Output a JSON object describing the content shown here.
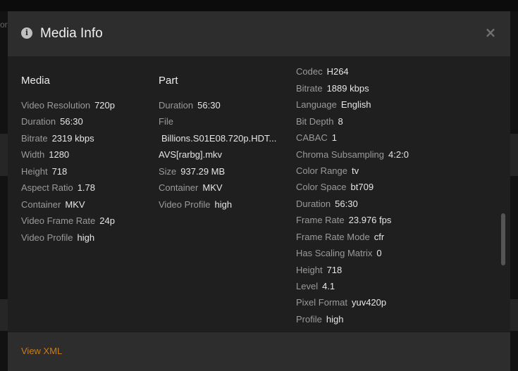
{
  "backdrop": {
    "edge_text": "or"
  },
  "modal": {
    "title": "Media Info",
    "info_icon_glyph": "i",
    "close_glyph": "×",
    "footer_link": "View XML"
  },
  "media": {
    "heading": "Media",
    "rows": [
      {
        "label": "Video Resolution",
        "value": "720p"
      },
      {
        "label": "Duration",
        "value": "56:30"
      },
      {
        "label": "Bitrate",
        "value": "2319 kbps"
      },
      {
        "label": "Width",
        "value": "1280"
      },
      {
        "label": "Height",
        "value": "718"
      },
      {
        "label": "Aspect Ratio",
        "value": "1.78"
      },
      {
        "label": "Container",
        "value": "MKV"
      },
      {
        "label": "Video Frame Rate",
        "value": "24p"
      },
      {
        "label": "Video Profile",
        "value": "high"
      }
    ]
  },
  "part": {
    "heading": "Part",
    "duration": {
      "label": "Duration",
      "value": "56:30"
    },
    "file": {
      "label": "File",
      "line1": "Billions.S01E08.720p.HDT...",
      "line2": "AVS[rarbg].mkv"
    },
    "rows": [
      {
        "label": "Size",
        "value": "937.29 MB"
      },
      {
        "label": "Container",
        "value": "MKV"
      },
      {
        "label": "Video Profile",
        "value": "high"
      }
    ]
  },
  "stream": {
    "rows": [
      {
        "label": "Codec",
        "value": "H264"
      },
      {
        "label": "Bitrate",
        "value": "1889 kbps"
      },
      {
        "label": "Language",
        "value": "English"
      },
      {
        "label": "Bit Depth",
        "value": "8"
      },
      {
        "label": "CABAC",
        "value": "1"
      },
      {
        "label": "Chroma Subsampling",
        "value": "4:2:0"
      },
      {
        "label": "Color Range",
        "value": "tv"
      },
      {
        "label": "Color Space",
        "value": "bt709"
      },
      {
        "label": "Duration",
        "value": "56:30"
      },
      {
        "label": "Frame Rate",
        "value": "23.976 fps"
      },
      {
        "label": "Frame Rate Mode",
        "value": "cfr"
      },
      {
        "label": "Has Scaling Matrix",
        "value": "0"
      },
      {
        "label": "Height",
        "value": "718"
      },
      {
        "label": "Level",
        "value": "4.1"
      },
      {
        "label": "Pixel Format",
        "value": "yuv420p"
      },
      {
        "label": "Profile",
        "value": "high"
      }
    ]
  },
  "colors": {
    "accent_link": "#cc7b19",
    "label_text": "#9a9a9a",
    "value_text": "#e6e6e6"
  }
}
